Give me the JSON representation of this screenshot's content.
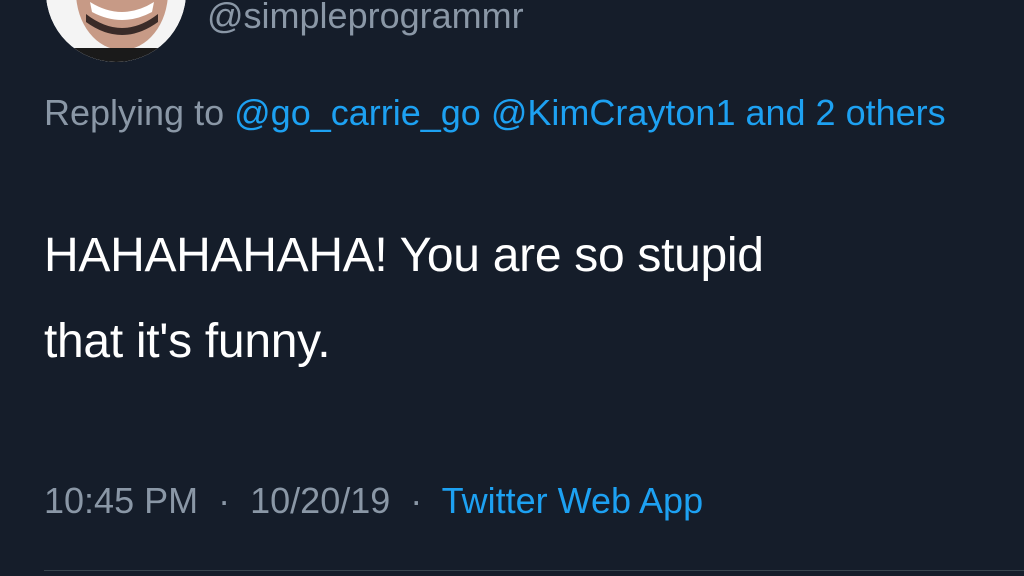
{
  "tweet": {
    "handle": "@simpleprogrammr",
    "reply": {
      "prefix": "Replying to",
      "mention1": "@go_carrie_go",
      "mention2": "@KimCrayton1",
      "others": "and 2 others"
    },
    "text_line1": "HAHAHAHAHA! You are so stupid",
    "text_line2": "that it's funny.",
    "time": "10:45 PM",
    "date": "10/20/19",
    "separator": "·",
    "source": "Twitter Web App"
  },
  "colors": {
    "background": "#151d2a",
    "secondary_text": "#8a97a6",
    "link": "#1da1f2",
    "primary_text": "#ffffff"
  },
  "icons": {
    "avatar": "profile-photo"
  }
}
